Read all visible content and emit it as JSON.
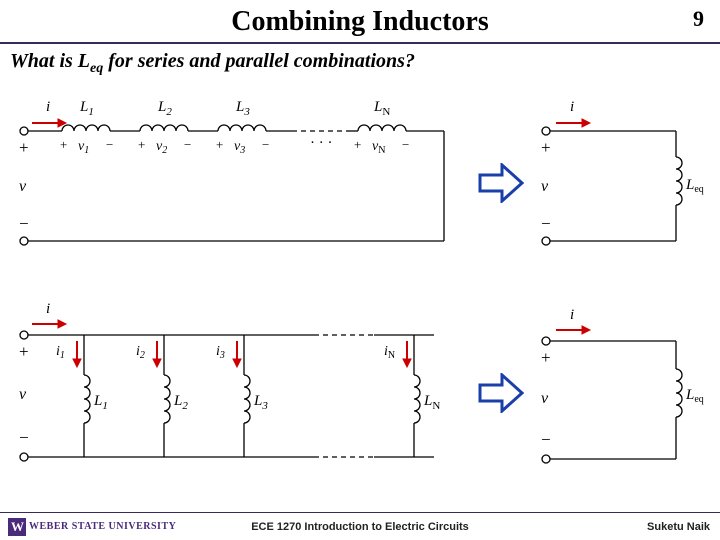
{
  "header": {
    "title": "Combining Inductors",
    "page": "9"
  },
  "subtitle": {
    "prefix": "What is L",
    "sub": "eq",
    "suffix": " for series and parallel combinations?"
  },
  "labels": {
    "i": "i",
    "v": "v",
    "plus": "+",
    "minus": "−",
    "L1": "L",
    "L1s": "1",
    "L2": "L",
    "L2s": "2",
    "L3": "L",
    "L3s": "3",
    "LN": "L",
    "LNs": "N",
    "v1": "v",
    "v1s": "1",
    "v2": "v",
    "v2s": "2",
    "v3": "v",
    "v3s": "3",
    "vN": "v",
    "vNs": "N",
    "i1": "i",
    "i1s": "1",
    "i2": "i",
    "i2s": "2",
    "i3": "i",
    "i3s": "3",
    "iN": "i",
    "iNs": "N",
    "Leq": "L",
    "Leqs": "eq",
    "dots": "· · ·"
  },
  "footer": {
    "univ": "WEBER STATE UNIVERSITY",
    "course": "ECE 1270 Introduction to Electric Circuits",
    "author": "Suketu Naik",
    "logoW": "W"
  }
}
